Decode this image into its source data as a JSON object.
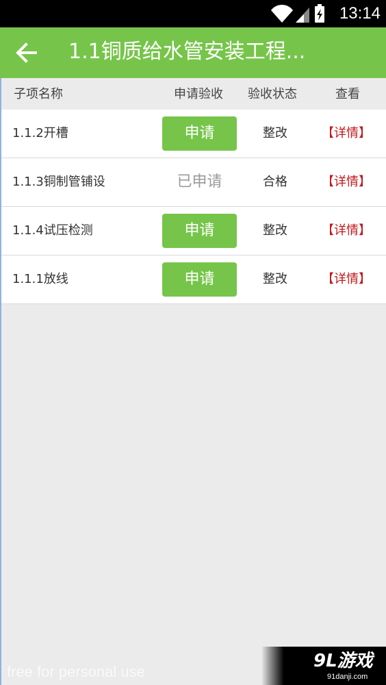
{
  "status_bar": {
    "time": "13:14",
    "icons": [
      "wifi-icon",
      "signal-icon",
      "battery-charging-icon"
    ]
  },
  "app_bar": {
    "back_icon": "arrow-left-icon",
    "title": "1.1铜质给水管安装工程..."
  },
  "table": {
    "headers": {
      "name": "子项名称",
      "apply": "申请验收",
      "status": "验收状态",
      "view": "查看"
    },
    "rows": [
      {
        "name": "1.1.2开槽",
        "apply_label": "申请",
        "applied": false,
        "status": "整改",
        "detail": "【详情】"
      },
      {
        "name": "1.1.3铜制管铺设",
        "apply_label": "已申请",
        "applied": true,
        "status": "合格",
        "detail": "【详情】"
      },
      {
        "name": "1.1.4试压检测",
        "apply_label": "申请",
        "applied": false,
        "status": "整改",
        "detail": "【详情】"
      },
      {
        "name": "1.1.1放线",
        "apply_label": "申请",
        "applied": false,
        "status": "整改",
        "detail": "【详情】"
      }
    ]
  },
  "watermark": {
    "text": "free for personal use",
    "logo": "9L游戏",
    "logo_sub": "91danji.com"
  },
  "colors": {
    "accent": "#76c54a",
    "detail": "#c0191c",
    "background": "#ebebeb"
  }
}
